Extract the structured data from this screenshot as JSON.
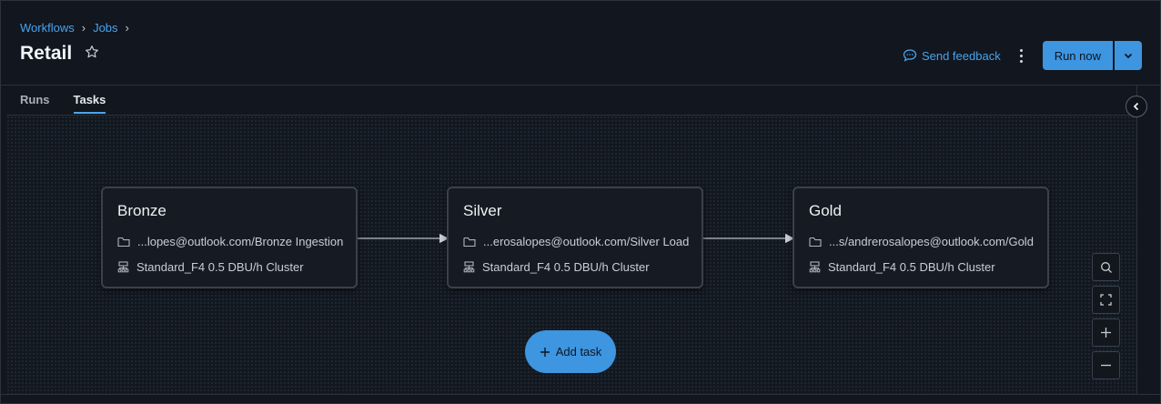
{
  "breadcrumb": {
    "items": [
      "Workflows",
      "Jobs"
    ],
    "sep": "›"
  },
  "header": {
    "title": "Retail",
    "feedback_label": "Send feedback",
    "run_label": "Run now"
  },
  "tabs": [
    {
      "label": "Runs",
      "active": false
    },
    {
      "label": "Tasks",
      "active": true
    }
  ],
  "tasks": [
    {
      "name": "Bronze",
      "path": "...lopes@outlook.com/Bronze Ingestion",
      "cluster": "Standard_F4 0.5 DBU/h Cluster"
    },
    {
      "name": "Silver",
      "path": "...erosalopes@outlook.com/Silver Load",
      "cluster": "Standard_F4 0.5 DBU/h Cluster"
    },
    {
      "name": "Gold",
      "path": "...s/andrerosalopes@outlook.com/Gold",
      "cluster": "Standard_F4 0.5 DBU/h Cluster"
    }
  ],
  "add_task_label": "Add task",
  "icons": {
    "star": "star-outline-icon",
    "feedback": "speech-bubble-icon",
    "more": "kebab-menu-icon",
    "caret": "chevron-down-icon",
    "collapse": "chevron-left-icon",
    "folder": "folder-icon",
    "cluster": "cluster-icon",
    "search": "search-icon",
    "fit": "fit-view-icon",
    "zoom_in": "plus-icon",
    "zoom_out": "minus-icon"
  },
  "colors": {
    "accent": "#3e95e0",
    "link": "#4aa3ea",
    "background": "#11161f"
  }
}
